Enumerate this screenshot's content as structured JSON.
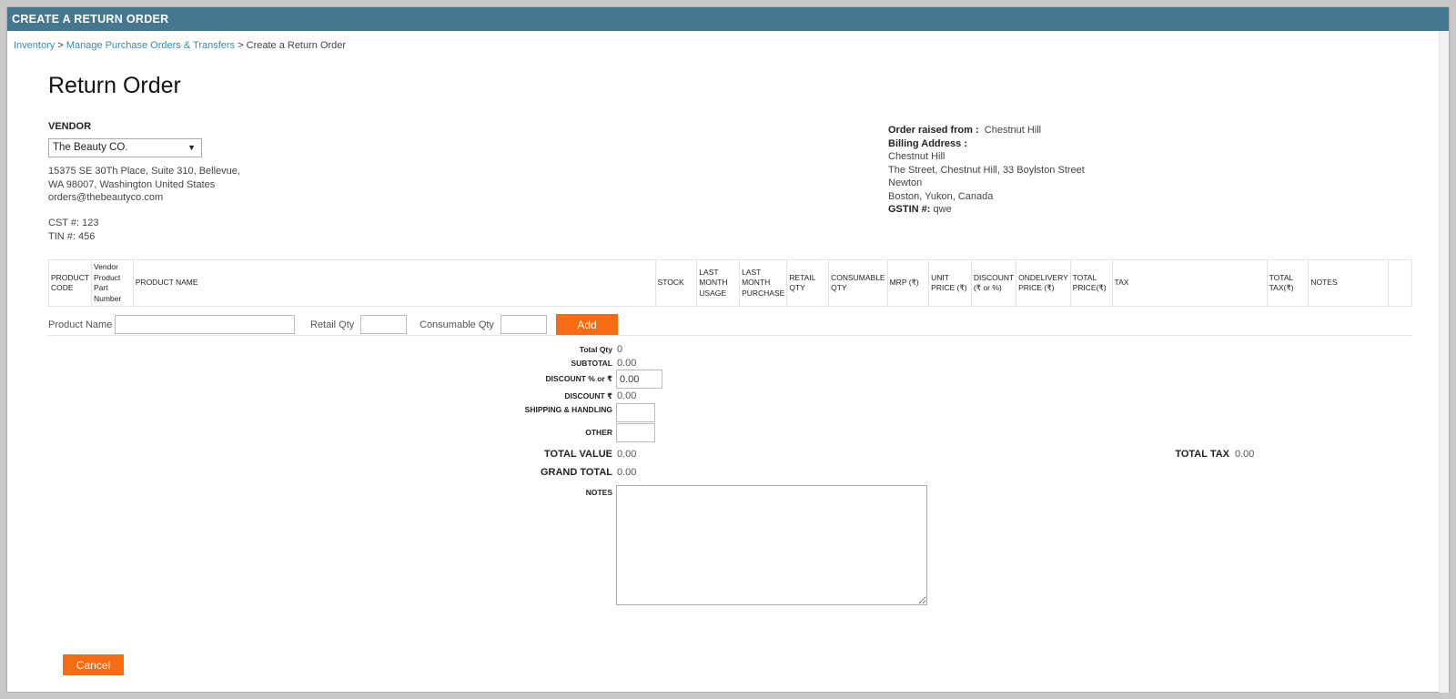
{
  "title": "CREATE A RETURN ORDER",
  "breadcrumb": {
    "items": [
      "Inventory",
      "Manage Purchase Orders & Transfers"
    ],
    "separator": ">",
    "current": "Create a Return Order"
  },
  "page_title": "Return Order",
  "vendor": {
    "label": "VENDOR",
    "selected": "The Beauty CO.",
    "address_line1": "15375 SE 30Th Place, Suite 310, Bellevue,",
    "address_line2": "WA 98007, Washington United States",
    "email": "orders@thebeautyco.com",
    "cst": "CST #: 123",
    "tin": "TIN #: 456"
  },
  "order_info": {
    "raised_from_label": "Order raised from :",
    "raised_from_value": "Chestnut Hill",
    "billing_label": "Billing Address :",
    "billing_lines": [
      "Chestnut Hill",
      "The Street, Chestnut Hill, 33 Boylston Street",
      "Newton",
      "Boston, Yukon, Canada"
    ],
    "gstin_label": "GSTIN #:",
    "gstin_value": "qwe"
  },
  "table": {
    "columns": [
      {
        "id": "product-code",
        "label": "PRODUCT CODE"
      },
      {
        "id": "vendor-part",
        "label": "Vendor Product Part Number"
      },
      {
        "id": "product-name",
        "label": "PRODUCT NAME"
      },
      {
        "id": "stock",
        "label": "STOCK"
      },
      {
        "id": "last-month-usage",
        "label": "LAST MONTH USAGE"
      },
      {
        "id": "last-month-purchase",
        "label": "LAST MONTH PURCHASE"
      },
      {
        "id": "retail-qty",
        "label": "RETAIL QTY"
      },
      {
        "id": "consumable-qty",
        "label": "CONSUMABLE QTY"
      },
      {
        "id": "mrp",
        "label": "MRP (₹)"
      },
      {
        "id": "unit-price",
        "label": "UNIT PRICE (₹)"
      },
      {
        "id": "discount",
        "label": "DISCOUNT (₹ or %)"
      },
      {
        "id": "ondelivery-price",
        "label": "ONDELIVERY PRICE (₹)"
      },
      {
        "id": "total-price",
        "label": "TOTAL PRICE(₹)"
      },
      {
        "id": "tax",
        "label": "TAX"
      },
      {
        "id": "total-tax",
        "label": "TOTAL TAX(₹)"
      },
      {
        "id": "notes",
        "label": "NOTES"
      },
      {
        "id": "actions",
        "label": ""
      }
    ]
  },
  "add_row": {
    "product_name_label": "Product Name",
    "retail_qty_label": "Retail Qty",
    "consumable_qty_label": "Consumable Qty",
    "add_label": "Add"
  },
  "summary": {
    "total_qty_label": "Total Qty",
    "total_qty": "0",
    "subtotal_label": "SUBTOTAL",
    "subtotal": "0.00",
    "discount_pct_label": "DISCOUNT % or ₹",
    "discount_pct_value": "0.00",
    "discount_amt_label": "DISCOUNT ₹",
    "discount_amt": "0.00",
    "shipping_label": "SHIPPING & HANDLING",
    "other_label": "OTHER",
    "total_value_label": "TOTAL VALUE",
    "total_value": "0.00",
    "grand_total_label": "GRAND TOTAL",
    "grand_total": "0.00",
    "total_tax_label": "TOTAL TAX",
    "total_tax": "0.00",
    "notes_label": "NOTES"
  },
  "cancel_label": "Cancel"
}
